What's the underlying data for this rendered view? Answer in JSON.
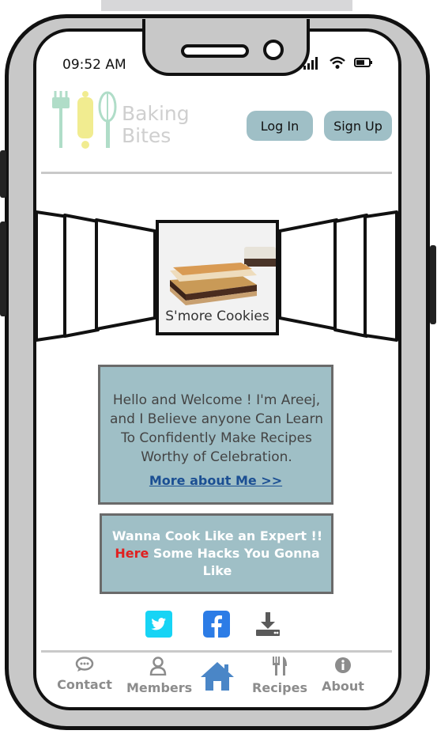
{
  "status_bar": {
    "time": "09:52 AM"
  },
  "logo": {
    "line1": "Baking",
    "line2": "Bites"
  },
  "header": {
    "login_label": "Log In",
    "signup_label": "Sign Up"
  },
  "carousel": {
    "caption": "S'more Cookies"
  },
  "welcome": {
    "message": "Hello and Welcome ! I'm Areej, and I Believe anyone Can Learn To Confidently Make Recipes Worthy of Celebration.",
    "link": "More about Me >>"
  },
  "hacks": {
    "part1": "Wanna Cook Like an Expert !! ",
    "highlight": "Here",
    "part2": " Some Hacks You Gonna Like"
  },
  "social": {
    "icons": [
      "twitter-icon",
      "facebook-icon",
      "download-icon"
    ]
  },
  "nav": {
    "contact": "Contact",
    "members": "Members",
    "recipes": "Recipes",
    "about": "About"
  },
  "colors": {
    "accent": "#9fbfc6",
    "link": "#1b4f93",
    "highlight": "#e02020"
  }
}
